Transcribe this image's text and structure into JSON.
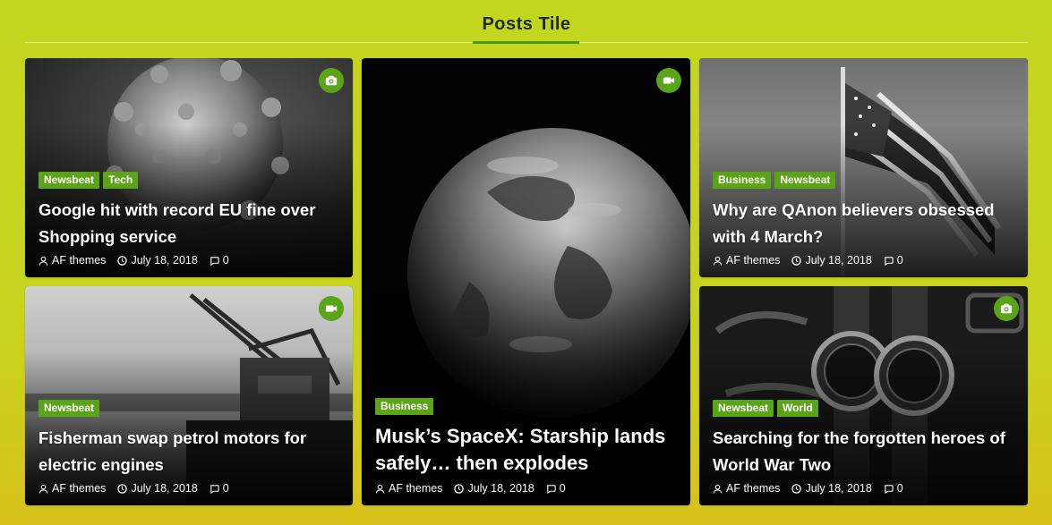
{
  "section": {
    "title": "Posts Tile"
  },
  "colors": {
    "accent": "#5aa418",
    "background": "#c3d61f"
  },
  "posts": [
    {
      "id": "covid",
      "media_icon": "camera-icon",
      "categories": [
        "Newsbeat",
        "Tech"
      ],
      "title": "Google hit with record EU fine over Shopping service",
      "author": "AF themes",
      "date": "July 18, 2018",
      "comments": "0"
    },
    {
      "id": "earth",
      "media_icon": "video-icon",
      "categories": [
        "Business"
      ],
      "title": "Musk’s SpaceX: Starship lands safely… then explodes",
      "author": "AF themes",
      "date": "July 18, 2018",
      "comments": "0"
    },
    {
      "id": "flag",
      "media_icon": null,
      "categories": [
        "Business",
        "Newsbeat"
      ],
      "title": "Why are QAnon believers obsessed with 4 March?",
      "author": "AF themes",
      "date": "July 18, 2018",
      "comments": "0"
    },
    {
      "id": "crane",
      "media_icon": "video-icon",
      "categories": [
        "Newsbeat"
      ],
      "title": "Fisherman swap petrol motors for electric engines",
      "author": "AF themes",
      "date": "July 18, 2018",
      "comments": "0"
    },
    {
      "id": "watches",
      "media_icon": "camera-icon",
      "categories": [
        "Newsbeat",
        "World"
      ],
      "title": "Searching for the forgotten heroes of World War Two",
      "author": "AF themes",
      "date": "July 18, 2018",
      "comments": "0"
    }
  ]
}
